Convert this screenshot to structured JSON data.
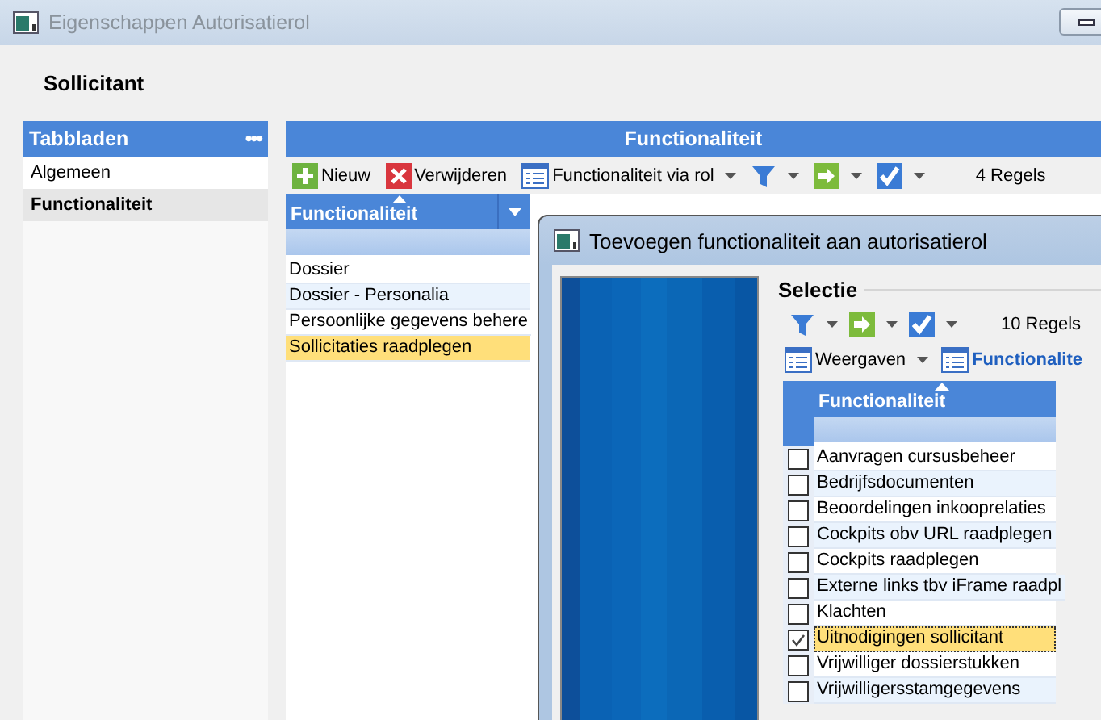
{
  "window": {
    "title": "Eigenschappen Autorisatierol"
  },
  "heading": "Sollicitant",
  "tabs_panel": {
    "title": "Tabbladen",
    "menu": "•••",
    "items": [
      {
        "label": "Algemeen",
        "selected": false
      },
      {
        "label": "Functionaliteit",
        "selected": true
      }
    ]
  },
  "main_panel": {
    "title": "Functionaliteit",
    "toolbar": [
      {
        "kind": "add",
        "label": "Nieuw",
        "dropdown": false
      },
      {
        "kind": "delete",
        "label": "Verwijderen",
        "dropdown": false
      },
      {
        "kind": "list",
        "label": "Functionaliteit via rol",
        "dropdown": true
      },
      {
        "kind": "filter",
        "dropdown": true
      },
      {
        "kind": "arrow",
        "dropdown": true
      },
      {
        "kind": "check",
        "dropdown": true
      }
    ],
    "count": "4 Regels",
    "grid": {
      "column": "Functionaliteit",
      "menu_button": true,
      "rows": [
        {
          "label": "Dossier",
          "selected": false
        },
        {
          "label": "Dossier - Personalia",
          "selected": false
        },
        {
          "label": "Persoonlijke gegevens behere",
          "selected": false
        },
        {
          "label": "Sollicitaties raadplegen",
          "selected": true
        }
      ]
    }
  },
  "dialog": {
    "title": "Toevoegen functionaliteit aan autorisatierol",
    "group": "Selectie",
    "toolbar": [
      {
        "kind": "filter",
        "dropdown": true
      },
      {
        "kind": "arrow",
        "dropdown": true
      },
      {
        "kind": "check",
        "dropdown": true
      }
    ],
    "count": "10 Regels",
    "views": [
      {
        "kind": "list",
        "label": "Weergaven",
        "dropdown": true,
        "active": false
      },
      {
        "kind": "list",
        "label": "Functionalite",
        "dropdown": false,
        "active": true
      }
    ],
    "grid": {
      "column": "Functionaliteit",
      "menu_button": false,
      "rows": [
        {
          "label": "Aanvragen cursusbeheer",
          "checked": false,
          "selected": false
        },
        {
          "label": "Bedrijfsdocumenten",
          "checked": false,
          "selected": false
        },
        {
          "label": "Beoordelingen inkooprelaties",
          "checked": false,
          "selected": false
        },
        {
          "label": "Cockpits obv URL raadplegen",
          "checked": false,
          "selected": false
        },
        {
          "label": "Cockpits raadplegen",
          "checked": false,
          "selected": false
        },
        {
          "label": "Externe links tbv iFrame raadpl",
          "checked": false,
          "selected": false
        },
        {
          "label": "Klachten",
          "checked": false,
          "selected": false
        },
        {
          "label": "Uitnodigingen sollicitant",
          "checked": true,
          "selected": true
        },
        {
          "label": "Vrijwilliger dossierstukken",
          "checked": false,
          "selected": false
        },
        {
          "label": "Vrijwilligersstamgegevens",
          "checked": false,
          "selected": false
        }
      ]
    }
  }
}
